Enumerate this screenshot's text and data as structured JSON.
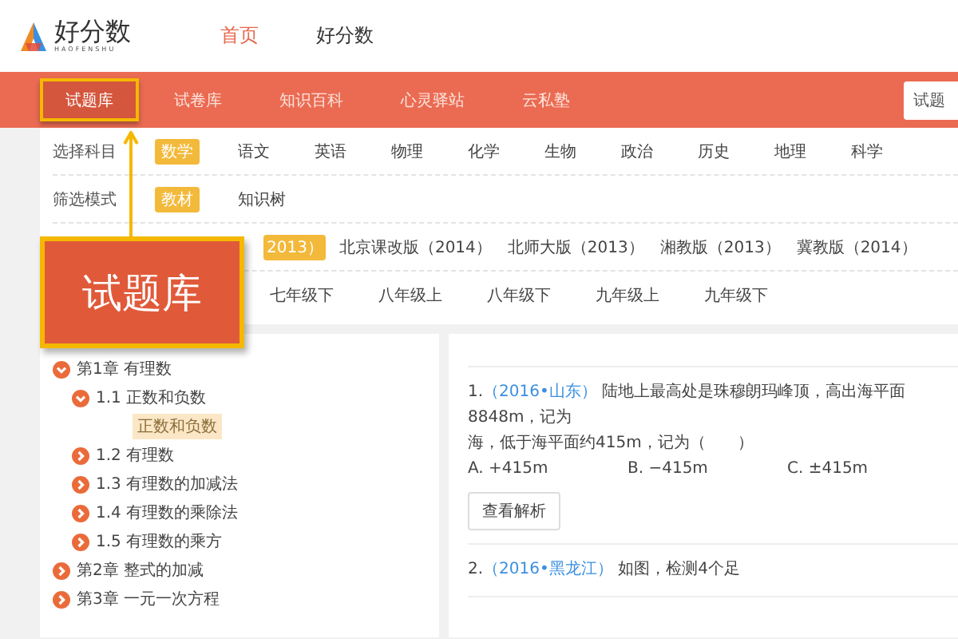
{
  "logo": {
    "name": "好分数",
    "subtitle": "HAOFENSHU"
  },
  "top_nav": [
    {
      "label": "首页",
      "selected": true
    },
    {
      "label": "好分数",
      "selected": false
    }
  ],
  "tabs": [
    {
      "label": "试题库",
      "selected": true
    },
    {
      "label": "试卷库",
      "selected": false
    },
    {
      "label": "知识百科",
      "selected": false
    },
    {
      "label": "心灵驿站",
      "selected": false
    },
    {
      "label": "云私塾",
      "selected": false
    }
  ],
  "search": {
    "value": "试题"
  },
  "filters": [
    {
      "label": "选择科目",
      "options": [
        {
          "label": "数学",
          "selected": true
        },
        {
          "label": "语文",
          "selected": false
        },
        {
          "label": "英语",
          "selected": false
        },
        {
          "label": "物理",
          "selected": false
        },
        {
          "label": "化学",
          "selected": false
        },
        {
          "label": "生物",
          "selected": false
        },
        {
          "label": "政治",
          "selected": false
        },
        {
          "label": "历史",
          "selected": false
        },
        {
          "label": "地理",
          "selected": false
        },
        {
          "label": "科学",
          "selected": false
        }
      ]
    },
    {
      "label": "筛选模式",
      "options": [
        {
          "label": "教材",
          "selected": true
        },
        {
          "label": "知识树",
          "selected": false
        }
      ]
    },
    {
      "options": [
        {
          "label": "2013）",
          "selected": true
        },
        {
          "label": "北京课改版（2014）",
          "selected": false
        },
        {
          "label": "北师大版（2013）",
          "selected": false
        },
        {
          "label": "湘教版（2013）",
          "selected": false
        },
        {
          "label": "冀教版（2014）",
          "selected": false
        }
      ]
    },
    {
      "options": [
        {
          "label": "七年级下",
          "selected": false
        },
        {
          "label": "八年级上",
          "selected": false
        },
        {
          "label": "八年级下",
          "selected": false
        },
        {
          "label": "九年级上",
          "selected": false
        },
        {
          "label": "九年级下",
          "selected": false
        }
      ]
    }
  ],
  "callout": {
    "text": "试题库"
  },
  "tree": [
    {
      "label": "第1章 有理数",
      "expanded": true,
      "children": [
        {
          "label": "1.1 正数和负数",
          "expanded": true,
          "children": [
            {
              "label": "正数和负数",
              "selected": true
            }
          ]
        },
        {
          "label": "1.2 有理数",
          "expanded": false
        },
        {
          "label": "1.3 有理数的加减法",
          "expanded": false
        },
        {
          "label": "1.4 有理数的乘除法",
          "expanded": false
        },
        {
          "label": "1.5 有理数的乘方",
          "expanded": false
        }
      ]
    },
    {
      "label": "第2章 整式的加减",
      "expanded": false
    },
    {
      "label": "第3章 一元一次方程",
      "expanded": false
    }
  ],
  "questions": [
    {
      "number": "1.",
      "source": "（2016•山东）",
      "lines": [
        "陆地上最高处是珠穆朗玛峰顶，高出海平面8848m，记为",
        "海，低于海平面约415m，记为（　　）"
      ],
      "options": [
        "A. +415m",
        "B. −415m",
        "C. ±415m"
      ],
      "button": "查看解析"
    },
    {
      "number": "2.",
      "source": "（2016•黑龙江）",
      "lines": [
        "如图，检测4个足"
      ]
    }
  ]
}
